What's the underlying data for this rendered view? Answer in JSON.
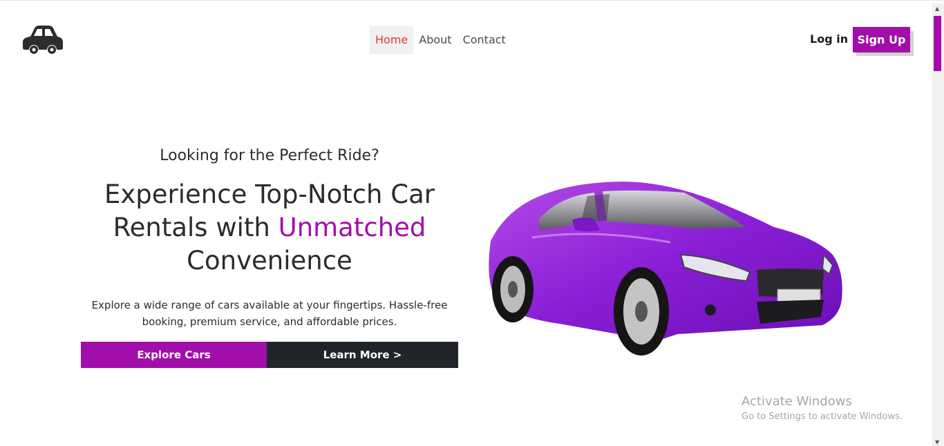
{
  "header": {
    "nav": [
      {
        "label": "Home",
        "active": true
      },
      {
        "label": "About",
        "active": false
      },
      {
        "label": "Contact",
        "active": false
      }
    ],
    "login_label": "Log in",
    "signup_label": "Sign Up"
  },
  "hero": {
    "kicker": "Looking for the Perfect Ride?",
    "headline_part1": "Experience Top-Notch Car Rentals with ",
    "headline_accent": "Unmatched",
    "headline_part2": " Convenience",
    "description": "Explore a wide range of cars available at your fingertips. Hassle-free booking, premium service, and affordable prices.",
    "explore_label": "Explore Cars",
    "learn_label": "Learn More >"
  },
  "watermark": {
    "title": "Activate Windows",
    "subtitle": "Go to Settings to activate Windows."
  },
  "colors": {
    "accent": "#a10ea9",
    "dark": "#212529",
    "active_nav": "#e8343a"
  },
  "icons": {
    "logo": "car-icon"
  }
}
